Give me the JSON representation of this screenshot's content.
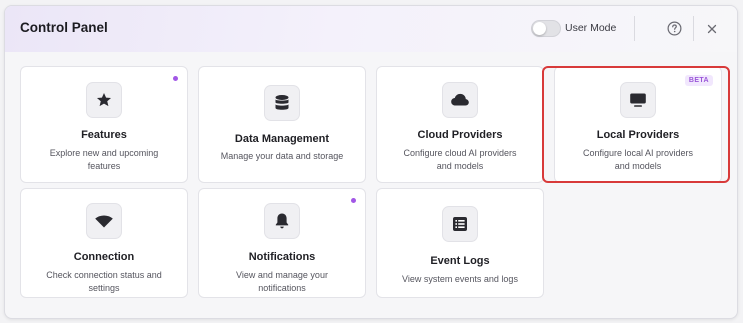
{
  "header": {
    "title": "Control Panel",
    "mode_label": "User Mode"
  },
  "cards": [
    {
      "title": "Features",
      "desc": [
        "Explore new and upcoming",
        "features"
      ],
      "icon": "star-icon",
      "dot": true
    },
    {
      "title": "Data Management",
      "desc": [
        "Manage your data and storage"
      ],
      "icon": "database-icon"
    },
    {
      "title": "Cloud Providers",
      "desc": [
        "Configure cloud AI providers",
        "and models"
      ],
      "icon": "cloud-icon"
    },
    {
      "title": "Local Providers",
      "desc": [
        "Configure local AI providers",
        "and models"
      ],
      "icon": "monitor-icon",
      "badge": "BETA"
    },
    {
      "title": "Connection",
      "desc": [
        "Check connection status and",
        "settings"
      ],
      "icon": "wifi-icon"
    },
    {
      "title": "Notifications",
      "desc": [
        "View and manage your",
        "notifications"
      ],
      "icon": "bell-icon",
      "dot": true
    },
    {
      "title": "Event Logs",
      "desc": [
        "View system events and logs"
      ],
      "icon": "list-icon"
    }
  ],
  "colors": {
    "accent": "#a257e6",
    "highlight": "#d83a3a"
  }
}
